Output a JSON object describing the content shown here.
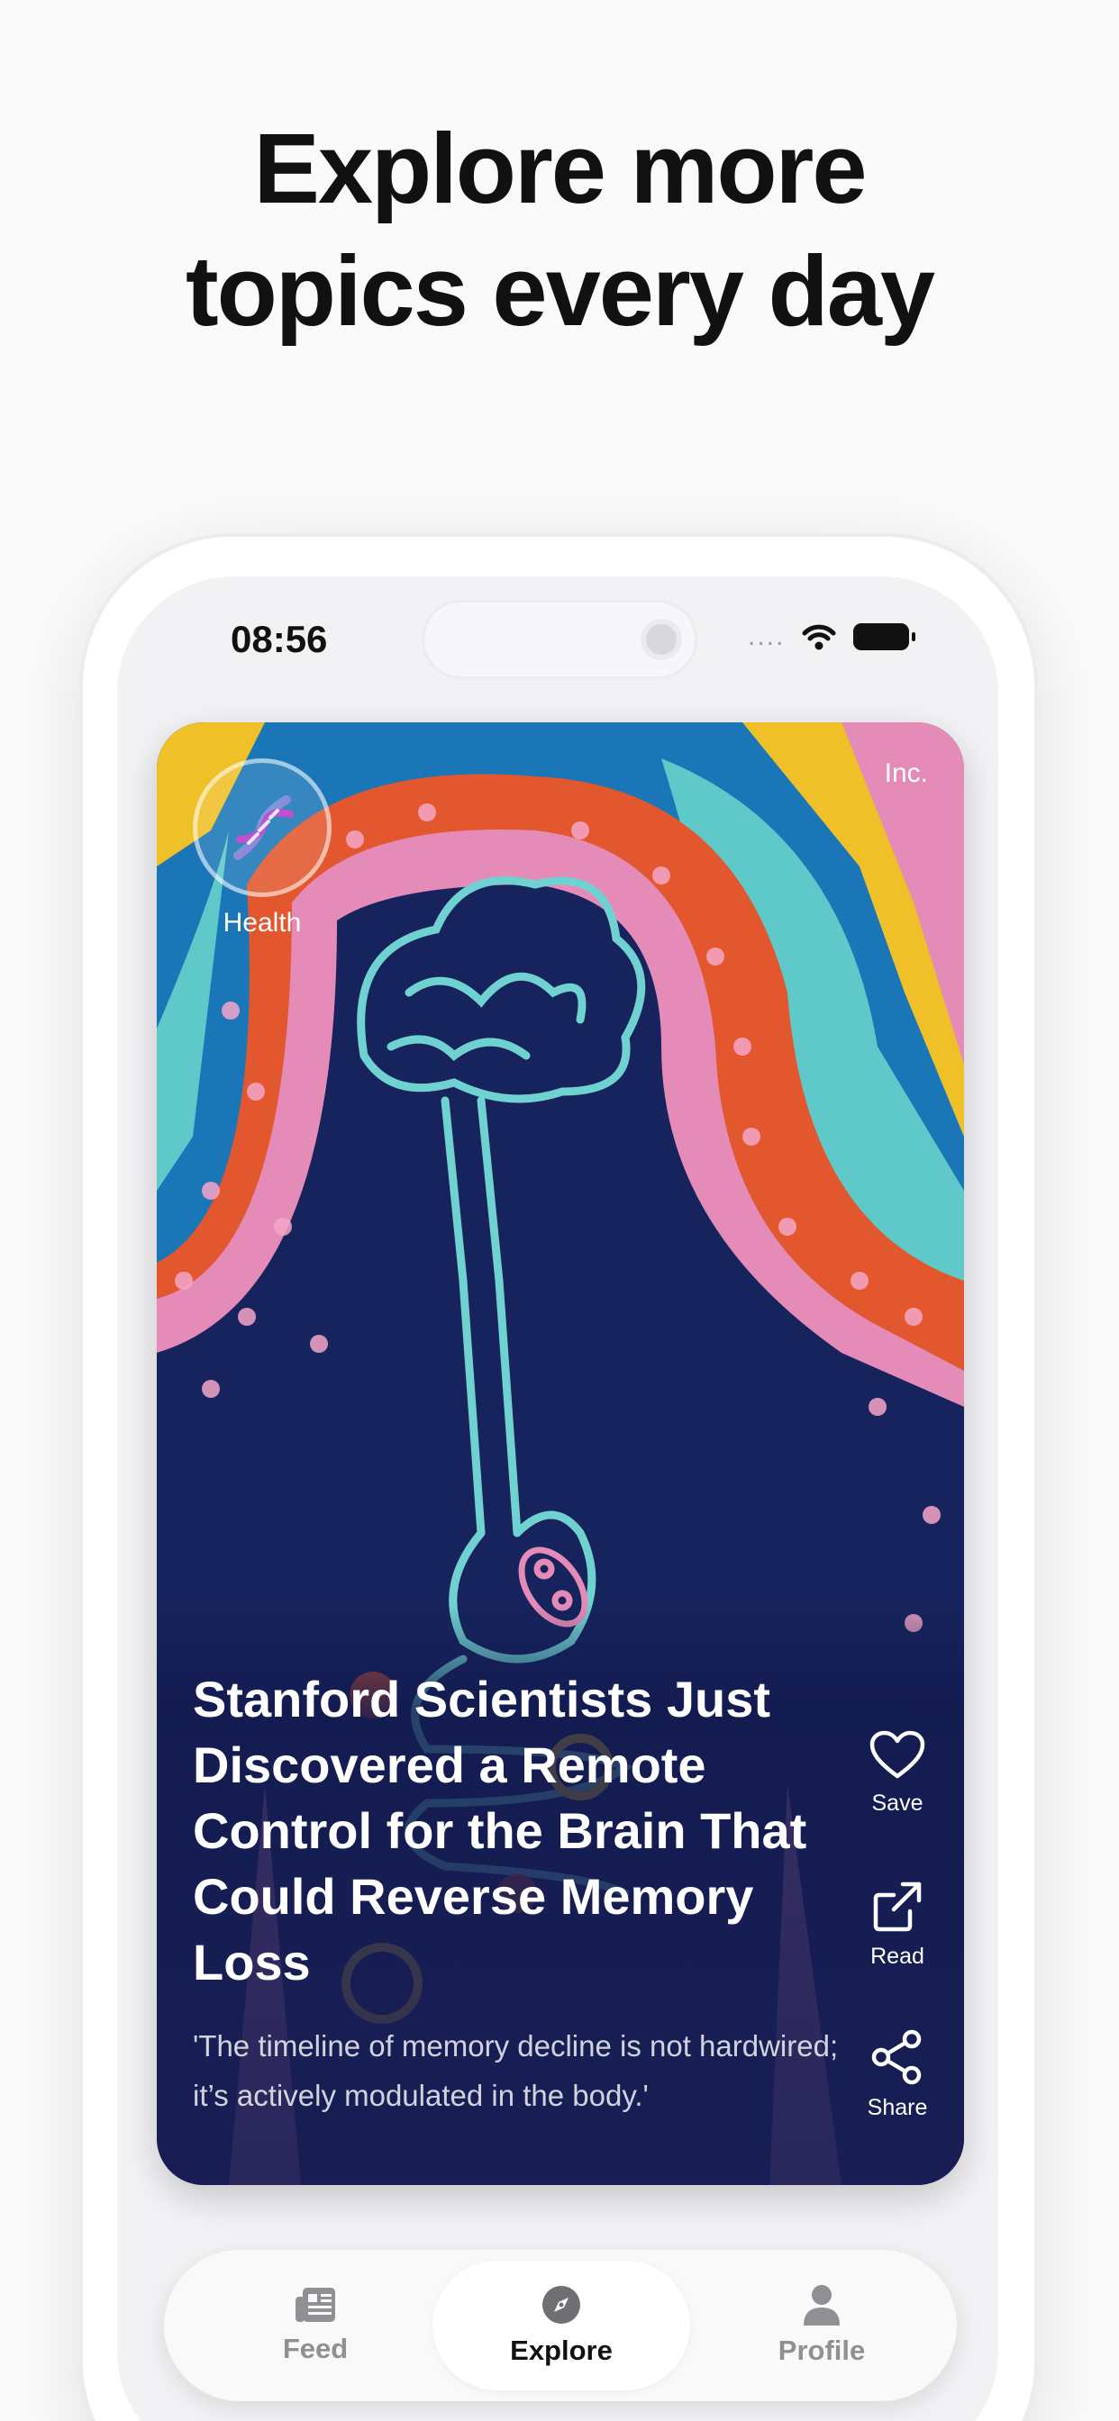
{
  "headline": {
    "line1": "Explore more",
    "line2": "topics every day"
  },
  "status_bar": {
    "time": "08:56",
    "signal": "....",
    "icons": [
      "wifi-icon",
      "battery-icon"
    ]
  },
  "card": {
    "topic": "Health",
    "topic_icon": "dna-icon",
    "source": "Inc.",
    "title": "Stanford Scientists Just Discovered a Remote Control for the Brain That Could Reverse Memory Loss",
    "quote": "'The timeline of memory decline is not hardwired; it’s actively modulated in the body.'",
    "actions": [
      {
        "label": "Save",
        "icon": "heart-icon"
      },
      {
        "label": "Read",
        "icon": "external-link-icon"
      },
      {
        "label": "Share",
        "icon": "share-icon"
      }
    ]
  },
  "tabbar": {
    "active": "Explore",
    "tabs": [
      {
        "label": "Feed",
        "icon": "newspaper-icon"
      },
      {
        "label": "Explore",
        "icon": "compass-icon"
      },
      {
        "label": "Profile",
        "icon": "person-icon"
      }
    ]
  },
  "colors": {
    "art_navy": "#17235c",
    "art_orange": "#e2572e",
    "art_pink": "#e58bb8",
    "art_teal": "#5fc8c9",
    "art_blue": "#1b76b8",
    "art_yellow": "#f0c028"
  }
}
